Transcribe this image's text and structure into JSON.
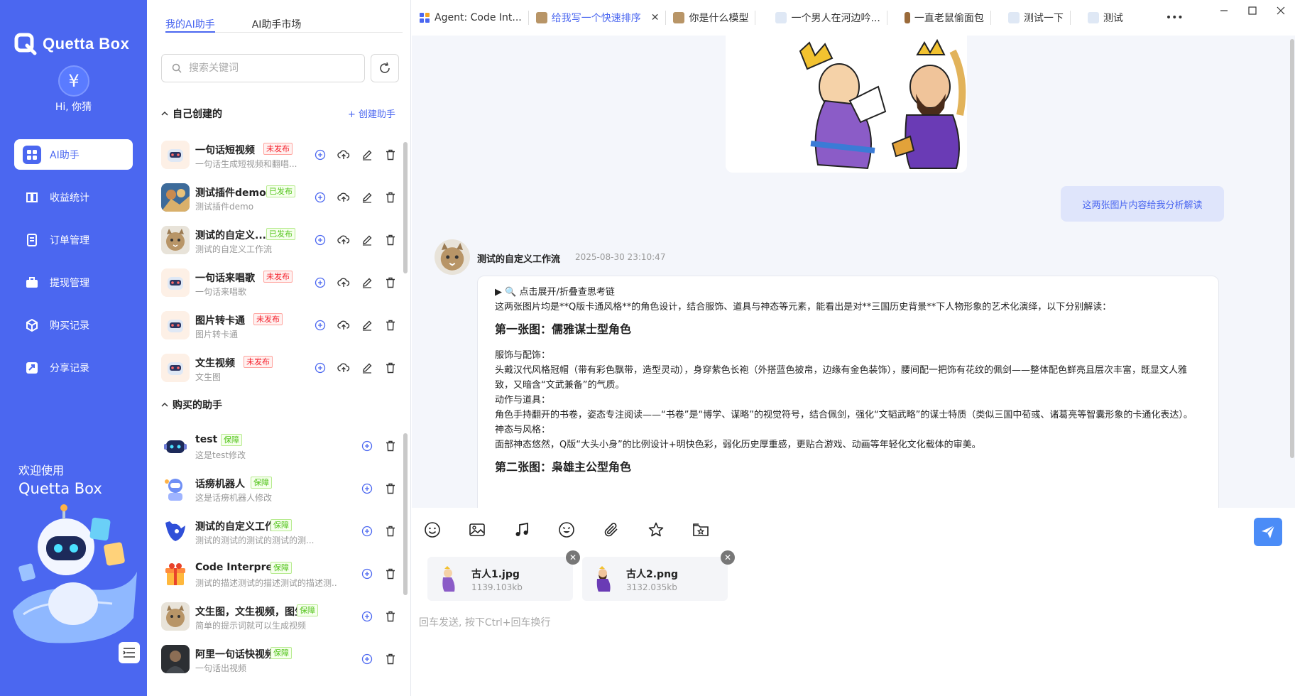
{
  "app": {
    "name": "Quetta Box",
    "brand_color": "#4b67f0"
  },
  "nav": {
    "greeting": "Hi, 你猜",
    "avatar_symbol": "¥",
    "items": [
      {
        "label": "AI助手",
        "icon": "apps-icon",
        "active": true
      },
      {
        "label": "收益统计",
        "icon": "book-icon",
        "active": false
      },
      {
        "label": "订单管理",
        "icon": "document-icon",
        "active": false
      },
      {
        "label": "提现管理",
        "icon": "briefcase-icon",
        "active": false
      },
      {
        "label": "购买记录",
        "icon": "cube-icon",
        "active": false
      },
      {
        "label": "分享记录",
        "icon": "share-icon",
        "active": false
      }
    ],
    "welcome_line1": "欢迎使用",
    "welcome_line2": "Quetta Box"
  },
  "panel": {
    "tabs": [
      {
        "label": "我的AI助手",
        "active": true
      },
      {
        "label": "AI助手市场",
        "active": false
      }
    ],
    "search_placeholder": "搜索关键词",
    "created_section": "自己创建的",
    "create_button": "+ 创建助手",
    "created": [
      {
        "name": "一句话短视频",
        "badge": "未发布",
        "status": "unpub",
        "desc": "一句话生成短视频和翻唱..."
      },
      {
        "name": "测试插件demo",
        "badge": "已发布",
        "status": "pub",
        "desc": "测试插件demo"
      },
      {
        "name": "测试的自定义...",
        "badge": "已发布",
        "status": "pub",
        "desc": "测试的自定义工作流"
      },
      {
        "name": "一句话来唱歌",
        "badge": "未发布",
        "status": "unpub",
        "desc": "一句话来唱歌"
      },
      {
        "name": "图片转卡通",
        "badge": "未发布",
        "status": "unpub",
        "desc": "图片转卡通"
      },
      {
        "name": "文生视频",
        "badge": "未发布",
        "status": "unpub",
        "desc": "文生图"
      }
    ],
    "bought_section": "购买的助手",
    "bought": [
      {
        "name": "test",
        "badge": "保障",
        "desc": "这是test修改"
      },
      {
        "name": "话痨机器人",
        "badge": "保障",
        "desc": "这是话痨机器人修改"
      },
      {
        "name": "测试的自定义工作流",
        "badge": "保障",
        "desc": "测试的测试的测试的测试的测..."
      },
      {
        "name": "Code Interpreter",
        "badge": "保障",
        "desc": "测试的描述测试的描述测试的描述测..."
      },
      {
        "name": "文生图，文生视频，图生...",
        "badge": "保障",
        "desc": "简单的提示词就可以生成视频"
      },
      {
        "name": "阿里一句话快视频",
        "badge": "保障",
        "desc": "一句话出视频"
      }
    ]
  },
  "tabs": [
    {
      "label": "Agent: Code Int...",
      "active": false
    },
    {
      "label": "给我写一个快速排序",
      "active": true
    },
    {
      "label": "你是什么模型",
      "active": false
    },
    {
      "label": "一个男人在河边吟...",
      "active": false
    },
    {
      "label": "一直老鼠偷面包",
      "active": false
    },
    {
      "label": "测试一下",
      "active": false
    },
    {
      "label": "测试",
      "active": false
    }
  ],
  "more_label": "•••",
  "chat": {
    "user_message": "这两张图片内容给我分析解读",
    "bot_name": "测试的自定义工作流",
    "bot_time": "2025-08-30 23:10:47",
    "think_toggle": "▶ 🔍 点击展开/折叠查思考链",
    "intro": "这两张图片均是**Q版卡通风格**的角色设计，结合服饰、道具与神态等元素，能看出是对**三国历史背景**下人物形象的艺术化演绎，以下分别解读：",
    "h1": "第一张图：儒雅谋士型角色",
    "p1": "服饰与配饰：",
    "p2": "头戴汉代风格冠帽（带有彩色飘带，造型灵动），身穿紫色长袍（外搭蓝色披帛，边缘有金色装饰），腰间配一把饰有花纹的佩剑——整体配色鲜亮且层次丰富，既显文人雅致，又暗含“文武兼备”的气质。",
    "p3": "动作与道具：",
    "p4": "角色手持翻开的书卷，姿态专注阅读——“书卷”是“博学、谋略”的视觉符号，结合佩剑，强化“文韬武略”的谋士特质（类似三国中荀彧、诸葛亮等智囊形象的卡通化表达）。",
    "p5": "神态与风格：",
    "p6": "面部神态悠然，Q版“大头小身”的比例设计+明快色彩，弱化历史厚重感，更贴合游戏、动画等年轻化文化载体的审美。",
    "h2": "第二张图：枭雄主公型角色"
  },
  "input": {
    "tools": [
      "emoji-icon",
      "image-icon",
      "music-icon",
      "smile-icon",
      "paperclip-icon",
      "star-icon",
      "folder-star-icon"
    ],
    "attachments": [
      {
        "name": "古人1.jpg",
        "size": "1139.103kb"
      },
      {
        "name": "古人2.png",
        "size": "3132.035kb"
      }
    ],
    "placeholder": "回车发送, 按下Ctrl+回车换行"
  }
}
